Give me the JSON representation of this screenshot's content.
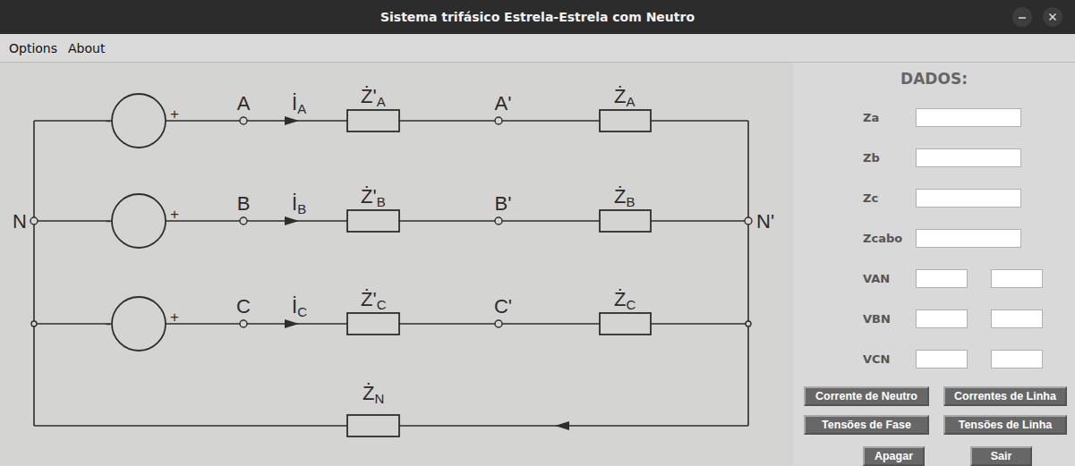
{
  "window": {
    "title": "Sistema trifásico Estrela-Estrela com Neutro"
  },
  "menu": [
    "Options",
    "About"
  ],
  "diagram": {
    "source_node": "N",
    "load_node": "N'",
    "phases": [
      {
        "minus": "-",
        "plus": "+",
        "terminal": "A",
        "current": {
          "symbol": "İ",
          "sub": "A"
        },
        "line_impedance": {
          "symbol": "Ż'",
          "sub": "A"
        },
        "node": "A'",
        "load_impedance": {
          "symbol": "Ż",
          "sub": "A"
        }
      },
      {
        "minus": "-",
        "plus": "+",
        "terminal": "B",
        "current": {
          "symbol": "İ",
          "sub": "B"
        },
        "line_impedance": {
          "symbol": "Ż'",
          "sub": "B"
        },
        "node": "B'",
        "load_impedance": {
          "symbol": "Ż",
          "sub": "B"
        }
      },
      {
        "minus": "-",
        "plus": "+",
        "terminal": "C",
        "current": {
          "symbol": "İ",
          "sub": "C"
        },
        "line_impedance": {
          "symbol": "Ż'",
          "sub": "C"
        },
        "node": "C'",
        "load_impedance": {
          "symbol": "Ż",
          "sub": "C"
        }
      }
    ],
    "neutral_impedance": {
      "symbol": "Ż",
      "sub": "N"
    }
  },
  "panel": {
    "title": "DADOS:",
    "fields": [
      {
        "label": "Za",
        "kind": "single"
      },
      {
        "label": "Zb",
        "kind": "single"
      },
      {
        "label": "Zc",
        "kind": "single"
      },
      {
        "label": "Zcabo",
        "kind": "single"
      },
      {
        "label": "VAN",
        "kind": "pair"
      },
      {
        "label": "VBN",
        "kind": "pair"
      },
      {
        "label": "VCN",
        "kind": "pair"
      }
    ],
    "buttons": [
      "Corrente de Neutro",
      "Correntes de Linha",
      "Tensões de Fase",
      "Tensões de Linha"
    ],
    "bottom_buttons": [
      "Apagar",
      "Sair"
    ]
  }
}
